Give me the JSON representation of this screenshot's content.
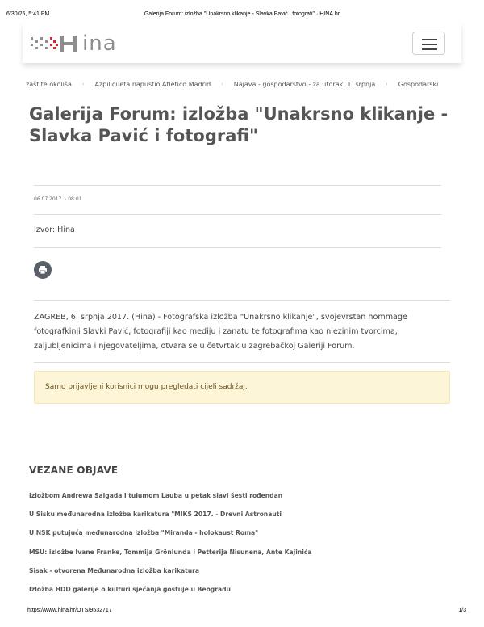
{
  "print_header": {
    "datetime": "6/30/25, 5:41 PM",
    "page_title": "Galerija Forum: izložba \"Unakrsno klikanje - Slavka Pavić i fotografi\" · HINA.hr"
  },
  "header": {
    "logo_text": "ina",
    "logo_icon": "hina-dots-logo-icon",
    "menu_icon": "hamburger-menu-icon"
  },
  "ticker": {
    "items": [
      "zaštite okoliša",
      "Azpilicueta napustio Atletico Madrid",
      "Najava - gospodarstvo - za utorak, 1. srpnja",
      "Gospodarski"
    ],
    "separator": "·"
  },
  "article": {
    "title": "Galerija Forum: izložba \"Unakrsno klikanje - Slavka Pavić i fotografi\"",
    "date": "06.07.2017. - 08:01",
    "source": "Izvor: Hina",
    "print_icon": "print-icon",
    "lead": "ZAGREB, 6. srpnja 2017. (Hina) - Fotografska izložba \"Unakrsno klikanje\", svojevrstan hommage fotografkinji Slavki Pavić, fotografiji kao mediju i zanatu te fotografima kao njezinim tvorcima, zaljubljenicima i njegovateljima, otvara se u četvrtak u zagrebačkoj Galeriji Forum.",
    "notice": "Samo prijavljeni korisnici mogu pregledati cijeli sadržaj."
  },
  "related": {
    "title": "VEZANE OBJAVE",
    "items": [
      "Izložbom Andrewa Salgada i tulumom Lauba u petak slavi šesti rođendan",
      "U Sisku međunarodna izložba karikatura \"MIKS 2017. - Drevni Astronauti",
      "U NSK putujuća međunarodna izložba \"Miranda - holokaust Roma\"",
      "MSU: izložbe Ivane Franke, Tommija Grönlunda i Petterija Nisunena, Ante Kajinića",
      "Sisak - otvorena Međunarodna izložba karikatura",
      "Izložba HDD galerije o kulturi sjećanja gostuje u Beogradu"
    ]
  },
  "print_footer": {
    "url": "https://www.hina.hr/OTS/9532717",
    "page": "1/3"
  },
  "colors": {
    "title": "#555555",
    "notice_bg": "#fdf5d7",
    "logo_red": "#e2202b",
    "logo_grey": "#8e8e8e"
  }
}
